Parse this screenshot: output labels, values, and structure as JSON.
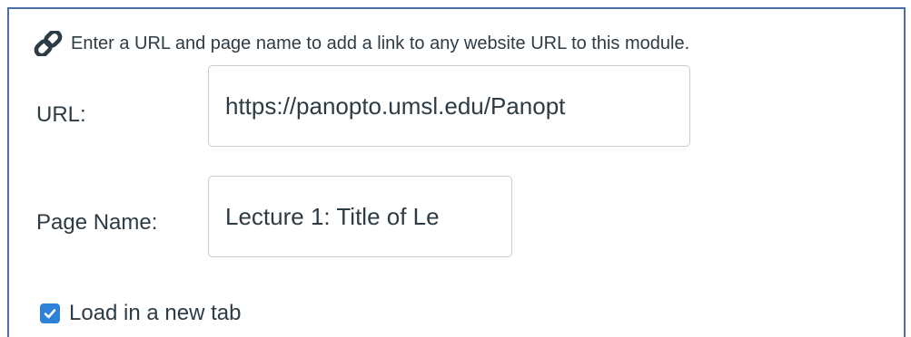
{
  "instruction": {
    "icon": "link-icon",
    "text": "Enter a URL and page name to add a link to any website URL to this module."
  },
  "url_field": {
    "label": "URL:",
    "value": "https://panopto.umsl.edu/Panopt"
  },
  "page_name_field": {
    "label": "Page Name:",
    "value": "Lecture 1: Title of Le"
  },
  "new_tab_option": {
    "label": "Load in a new tab",
    "checked": true
  },
  "colors": {
    "frame_border": "#4a6fa5",
    "text": "#2d3b45",
    "checkbox_fill": "#2d81d7",
    "input_border": "#c7cdd1"
  }
}
